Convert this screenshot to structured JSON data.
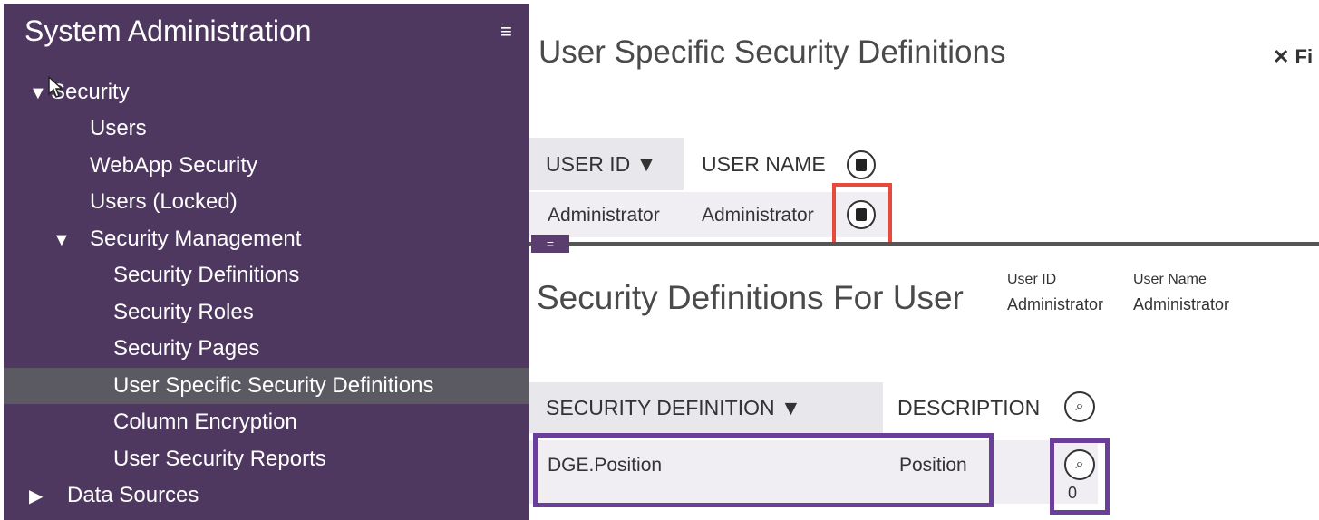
{
  "sidebar": {
    "title": "System Administration",
    "menu_icon": "≡",
    "tree": [
      {
        "label": "Security",
        "toggle": "▼",
        "expanded": true
      },
      {
        "label": "Users"
      },
      {
        "label": "WebApp Security"
      },
      {
        "label": "Users (Locked)"
      },
      {
        "label": "Security Management",
        "toggle": "▼",
        "expanded": true
      },
      {
        "label": "Security Definitions"
      },
      {
        "label": "Security Roles"
      },
      {
        "label": "Security Pages"
      },
      {
        "label": "User Specific Security Definitions",
        "selected": true
      },
      {
        "label": "Column Encryption"
      },
      {
        "label": "User Security Reports"
      },
      {
        "label": "Data Sources",
        "toggle": "▶",
        "expanded": false
      }
    ]
  },
  "main": {
    "page_title": "User Specific Security Definitions",
    "close_filter": "✕ Fi",
    "users_grid": {
      "headers": [
        "USER ID ▼",
        "USER NAME"
      ],
      "rows": [
        {
          "user_id": "Administrator",
          "user_name": "Administrator"
        }
      ]
    },
    "splitter_label": "=",
    "detail": {
      "title": "Security Definitions For User",
      "user_id_label": "User ID",
      "user_id_value": "Administrator",
      "user_name_label": "User Name",
      "user_name_value": "Administrator"
    },
    "defs_grid": {
      "headers": [
        "SECURITY DEFINITION ▼",
        "DESCRIPTION"
      ],
      "rows": [
        {
          "definition": "DGE.Position",
          "description": "Position",
          "count": "0"
        }
      ]
    }
  },
  "colors": {
    "sidebar_bg": "#4f385f",
    "sidebar_selected": "#5b5a63",
    "highlight_red": "#e54a3c",
    "highlight_purple": "#6b3e9a"
  },
  "icons": {
    "open_record": "book-icon",
    "search": "key-search-icon"
  }
}
